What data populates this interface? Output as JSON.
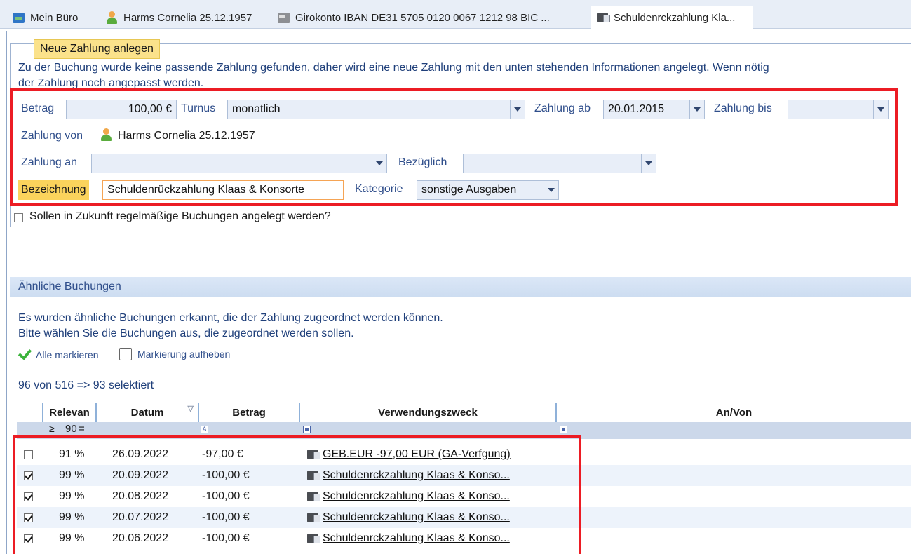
{
  "tabs": [
    {
      "label": "Mein Büro",
      "icon": "office-icon"
    },
    {
      "label": "Harms Cornelia 25.12.1957",
      "icon": "person-icon"
    },
    {
      "label": "Girokonto IBAN DE31 5705 0120 0067 1212 98 BIC ...",
      "icon": "bank-account-icon"
    },
    {
      "label": "Schuldenrckzahlung Kla...",
      "icon": "booking-icon",
      "active": true
    }
  ],
  "form": {
    "legend": "Neue Zahlung anlegen",
    "info_line1": "Zu der Buchung wurde keine passende Zahlung gefunden, daher wird eine neue Zahlung mit den unten stehenden Informationen angelegt. Wenn nötig",
    "info_line2": "der Zahlung noch angepasst werden.",
    "betrag_label": "Betrag",
    "betrag_value": "100,00 €",
    "turnus_label": "Turnus",
    "turnus_value": "monatlich",
    "zahlung_ab_label": "Zahlung ab",
    "zahlung_ab_value": "20.01.2015",
    "zahlung_bis_label": "Zahlung bis",
    "zahlung_bis_value": "",
    "zahlung_von_label": "Zahlung von",
    "zahlung_von_value": "Harms Cornelia 25.12.1957",
    "zahlung_an_label": "Zahlung an",
    "zahlung_an_value": "",
    "bezueglich_label": "Bezüglich",
    "bezueglich_value": "",
    "bezeichnung_label": "Bezeichnung",
    "bezeichnung_value": "Schuldenrückzahlung Klaas & Konsorte",
    "kategorie_label": "Kategorie",
    "kategorie_value": "sonstige Ausgaben",
    "recurring_label": "Sollen in Zukunft regelmäßige Buchungen angelegt werden?"
  },
  "similar": {
    "section_title": "Ähnliche Buchungen",
    "info_line1": "Es wurden ähnliche Buchungen erkannt, die der Zahlung zugeordnet werden können.",
    "info_line2": "Bitte wählen Sie die Buchungen aus, die zugeordnet werden sollen.",
    "select_all": "Alle markieren",
    "deselect": "Markierung aufheben",
    "count_text": "96 von 516 => 93 selektiert"
  },
  "table": {
    "headers": {
      "relevance": "Relevan",
      "date": "Datum",
      "amount": "Betrag",
      "purpose": "Verwendungszweck",
      "party": "An/Von"
    },
    "filter": {
      "op": "≥",
      "value": "90",
      "eq": "="
    },
    "rows": [
      {
        "checked": false,
        "relevance": "91 %",
        "date": "26.09.2022",
        "amount": "-97,00 €",
        "purpose": "GEB.EUR -97,00 EUR (GA-Verfgung)"
      },
      {
        "checked": true,
        "relevance": "99 %",
        "date": "20.09.2022",
        "amount": "-100,00 €",
        "purpose": "Schuldenrckzahlung Klaas & Konso..."
      },
      {
        "checked": true,
        "relevance": "99 %",
        "date": "20.08.2022",
        "amount": "-100,00 €",
        "purpose": "Schuldenrckzahlung Klaas & Konso..."
      },
      {
        "checked": true,
        "relevance": "99 %",
        "date": "20.07.2022",
        "amount": "-100,00 €",
        "purpose": "Schuldenrckzahlung Klaas & Konso..."
      },
      {
        "checked": true,
        "relevance": "99 %",
        "date": "20.06.2022",
        "amount": "-100,00 €",
        "purpose": "Schuldenrckzahlung Klaas & Konso..."
      }
    ]
  },
  "colors": {
    "highlight": "#ec1c24",
    "legend_bg": "#fbe28b",
    "label_blue": "#2f4e8b"
  }
}
